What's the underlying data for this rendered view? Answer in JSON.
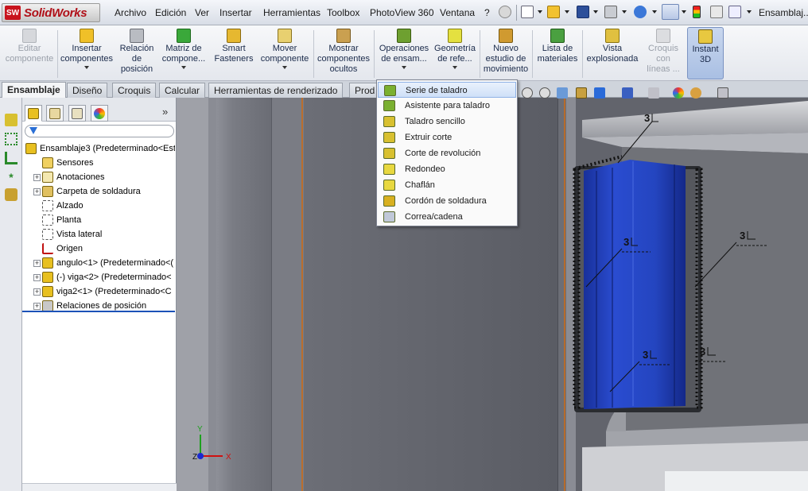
{
  "app": {
    "logo_text": "SolidWorks",
    "logo_mark": "SW",
    "document_title": "Ensamblaj..."
  },
  "menu": [
    "Archivo",
    "Edición",
    "Ver",
    "Insertar",
    "Herramientas",
    "Toolbox",
    "PhotoView 360",
    "Ventana",
    "?"
  ],
  "commands": [
    {
      "label": "Editar componente",
      "lines": [
        "Editar",
        "componente"
      ],
      "icon": "edit-component-icon",
      "disabled": true
    },
    {
      "label": "Insertar componentes",
      "lines": [
        "Insertar",
        "componentes"
      ],
      "icon": "insert-components-icon"
    },
    {
      "label": "Relación de posición",
      "lines": [
        "Relación",
        "de",
        "posición"
      ],
      "icon": "mate-icon"
    },
    {
      "label": "Matriz de compone...",
      "lines": [
        "Matriz de",
        "compone..."
      ],
      "icon": "pattern-icon"
    },
    {
      "label": "Smart Fasteners",
      "lines": [
        "Smart",
        "Fasteners"
      ],
      "icon": "smart-fasteners-icon"
    },
    {
      "label": "Mover componente",
      "lines": [
        "Mover",
        "componente"
      ],
      "icon": "move-component-icon"
    },
    {
      "label": "Mostrar componentes ocultos",
      "lines": [
        "Mostrar",
        "componentes",
        "ocultos"
      ],
      "icon": "show-hidden-icon"
    },
    {
      "label": "Operaciones de ensam...",
      "lines": [
        "Operaciones",
        "de ensam..."
      ],
      "icon": "assembly-features-icon"
    },
    {
      "label": "Geometría de refe...",
      "lines": [
        "Geometría",
        "de refe..."
      ],
      "icon": "reference-geometry-icon"
    },
    {
      "label": "Nuevo estudio de movimiento",
      "lines": [
        "Nuevo",
        "estudio de",
        "movimiento"
      ],
      "icon": "motion-study-icon"
    },
    {
      "label": "Lista de materiales",
      "lines": [
        "Lista de",
        "materiales"
      ],
      "icon": "bom-icon"
    },
    {
      "label": "Vista explosionada",
      "lines": [
        "Vista",
        "explosionada"
      ],
      "icon": "exploded-view-icon"
    },
    {
      "label": "Croquis con líneas ...",
      "lines": [
        "Croquis",
        "con",
        "líneas ..."
      ],
      "icon": "explode-line-sketch-icon",
      "disabled": true
    },
    {
      "label": "Instant 3D",
      "lines": [
        "Instant",
        "3D"
      ],
      "icon": "instant3d-icon",
      "active": true
    }
  ],
  "tabs": [
    "Ensamblaje",
    "Diseño",
    "Croquis",
    "Calcular",
    "Herramientas de renderizado",
    "Prod"
  ],
  "active_tab": "Ensamblaje",
  "tree": [
    {
      "label": "Ensamblaje3  (Predeterminado<Est",
      "icon": "assembly-icon",
      "expand": false
    },
    {
      "label": "Sensores",
      "icon": "sensor-icon"
    },
    {
      "label": "Anotaciones",
      "icon": "annotations-icon",
      "expand": true
    },
    {
      "label": "Carpeta de soldadura",
      "icon": "weld-folder-icon",
      "expand": true
    },
    {
      "label": "Alzado",
      "icon": "plane-icon"
    },
    {
      "label": "Planta",
      "icon": "plane-icon"
    },
    {
      "label": "Vista lateral",
      "icon": "plane-icon"
    },
    {
      "label": "Origen",
      "icon": "origin-icon"
    },
    {
      "label": "angulo<1> (Predeterminado<(",
      "icon": "part-icon",
      "expand": true
    },
    {
      "label": "(-) viga<2> (Predeterminado<",
      "icon": "part-icon",
      "expand": true
    },
    {
      "label": "viga2<1> (Predeterminado<C",
      "icon": "part-icon",
      "expand": true
    },
    {
      "label": "Relaciones de posición",
      "icon": "mates-folder-icon",
      "expand": true
    }
  ],
  "dropdown": [
    "Serie de taladro",
    "Asistente para taladro",
    "Taladro sencillo",
    "Extruir corte",
    "Corte de revolución",
    "Redondeo",
    "Chaflán",
    "Cordón de soldadura",
    "Correa/cadena"
  ],
  "dropdown_highlighted": "Serie de taladro",
  "weld_labels": [
    "3",
    "3",
    "3",
    "3",
    "3"
  ],
  "triad": {
    "z": "Z",
    "y": "Y",
    "x": "X"
  },
  "colors": {
    "accent": "#2a5fc0",
    "part_blue": "#1f3fb8",
    "steel": "#8a8c94",
    "weld": "#3a3a3a"
  }
}
